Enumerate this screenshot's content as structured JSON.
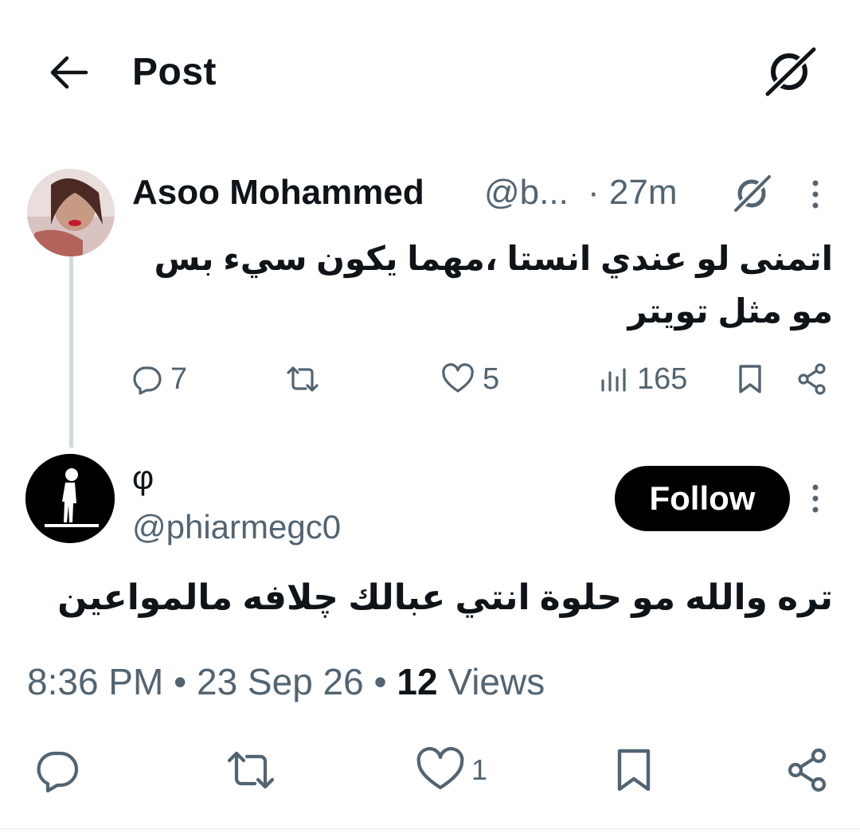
{
  "header": {
    "title": "Post",
    "back_icon": "arrow-left-icon",
    "grok_icon": "grok-icon"
  },
  "tweet1": {
    "name": "Asoo Mohammed",
    "handle": "@b...",
    "time": "· 27m",
    "text": "اتمنى لو عندي انستا ،مهما يكون سيء بس مو مثل تويتر",
    "replies": "7",
    "retweets": "",
    "likes": "5",
    "views": "165"
  },
  "tweet2": {
    "name": "φ",
    "handle": "@phiarmegc0",
    "follow_label": "Follow",
    "text": "تره والله مو حلوة انتي عبالك چلافه مالمواعين",
    "time": "8:36 PM",
    "date": "23 Sep 26",
    "views_count": "12",
    "views_label": "Views",
    "likes": "1"
  },
  "colors": {
    "text": "#0f1419",
    "muted": "#536471",
    "thread_line": "#cfd9de",
    "follow_bg": "#000000"
  }
}
